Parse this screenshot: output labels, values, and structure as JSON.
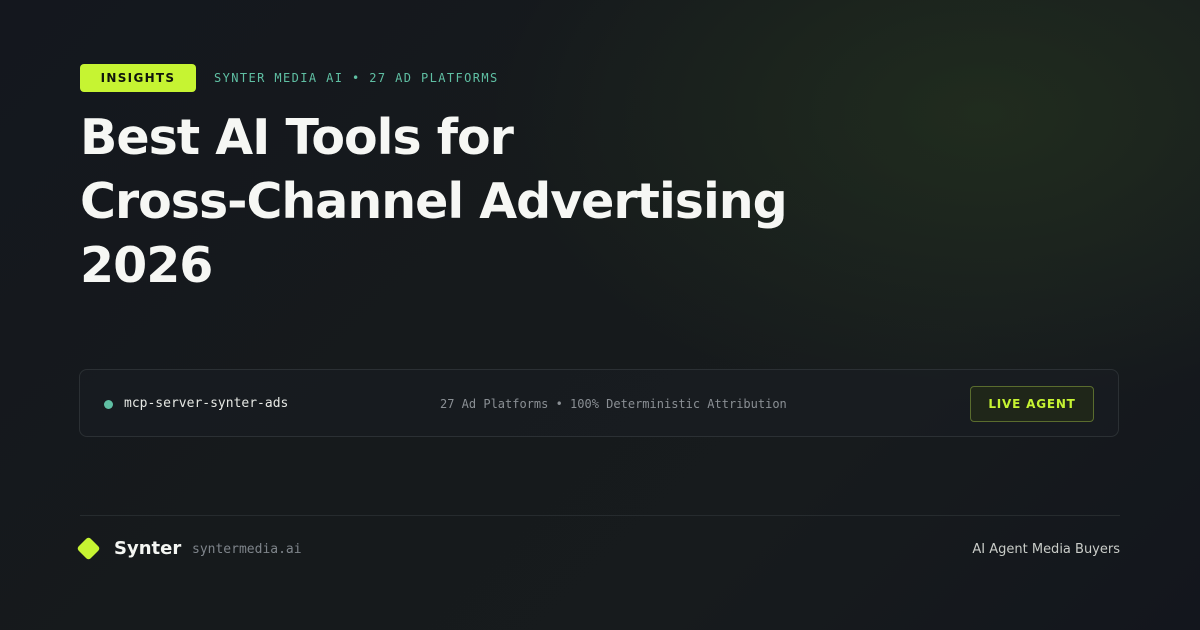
{
  "header": {
    "badge": "INSIGHTS",
    "meta": "SYNTER MEDIA AI • 27 AD PLATFORMS"
  },
  "headline": {
    "lines": [
      "Best AI Tools for",
      "Cross-Channel Advertising",
      "2026"
    ]
  },
  "agent_bar": {
    "status_color": "#5fbfa3",
    "server_name": "mcp-server-synter-ads",
    "stats": "27 Ad Platforms • 100% Deterministic Attribution",
    "button_label": "LIVE AGENT"
  },
  "footer": {
    "brand_icon": "diamond-logo-icon",
    "brand_name": "Synter",
    "domain": "syntermedia.ai",
    "tagline": "AI Agent Media Buyers"
  },
  "colors": {
    "accent": "#c6f432",
    "teal": "#5fbfa3",
    "background": "#14171e"
  }
}
